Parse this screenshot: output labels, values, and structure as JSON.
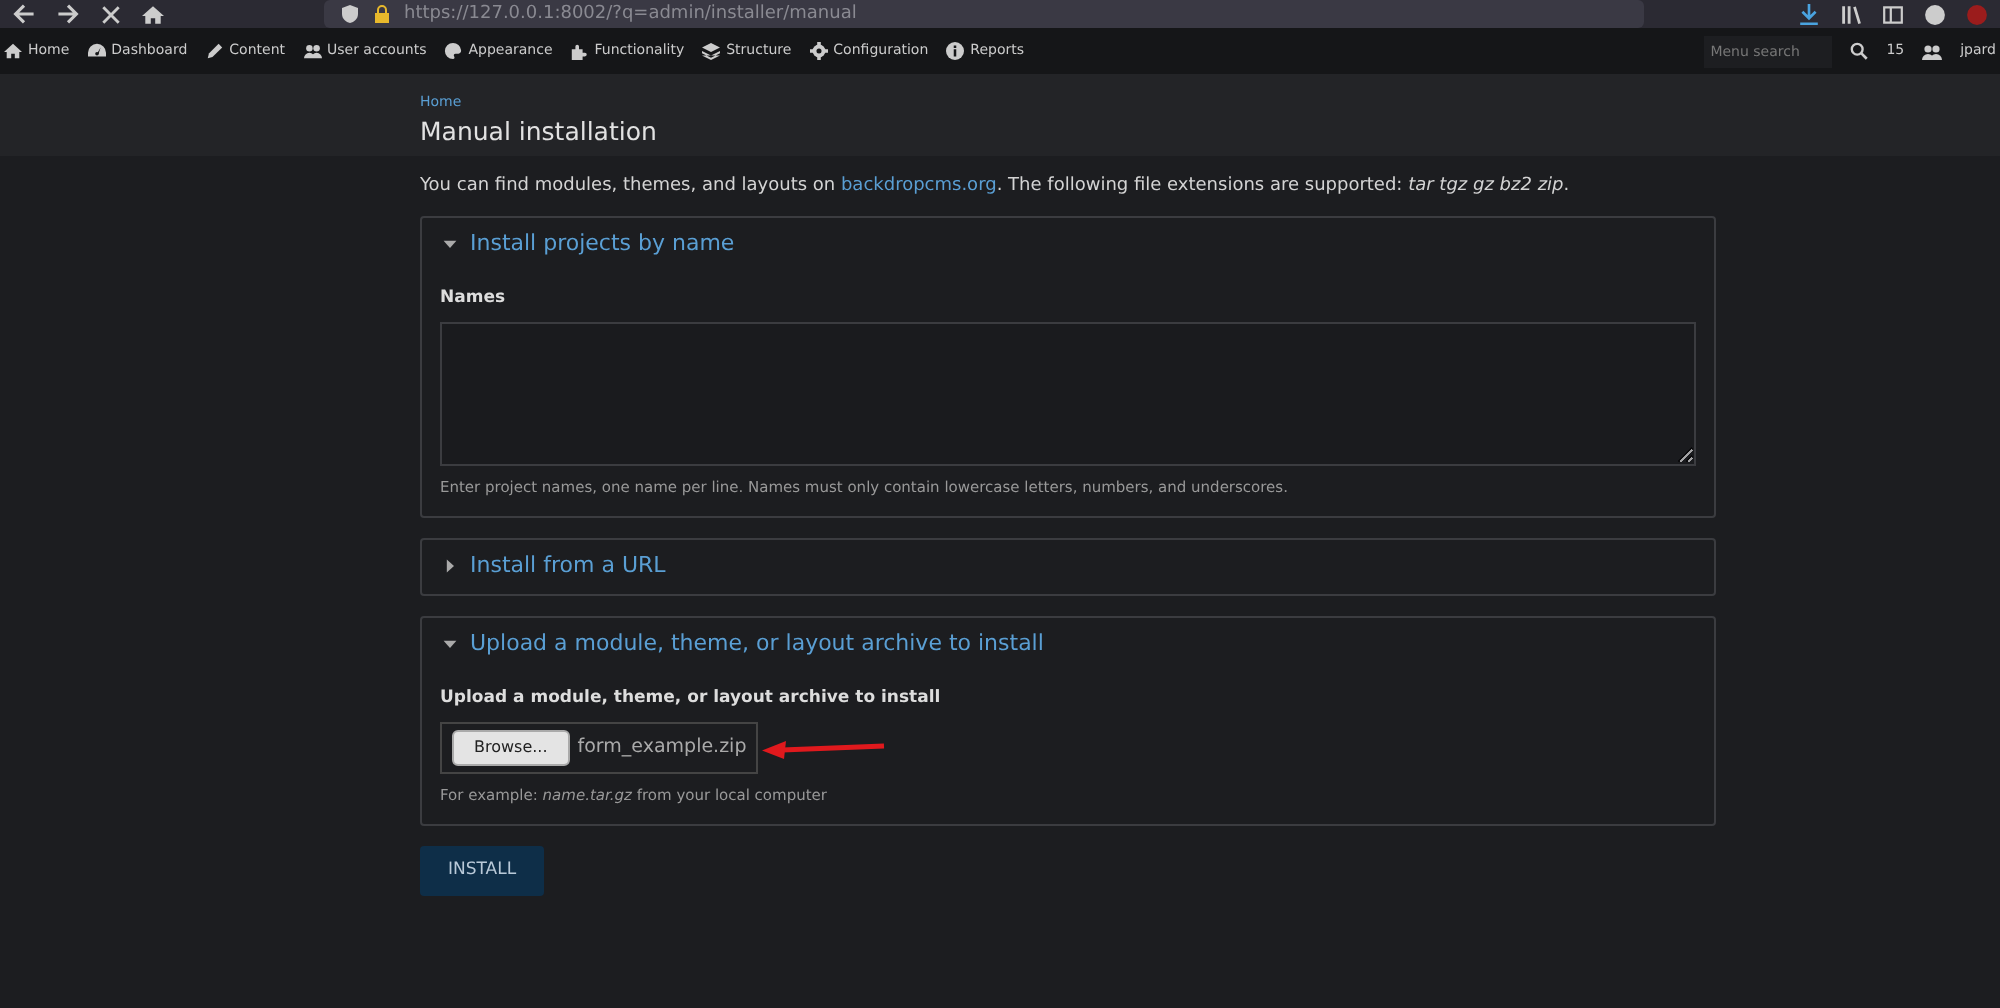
{
  "browser": {
    "url": "https://127.0.0.1:8002/?q=admin/installer/manual"
  },
  "admin_bar": {
    "items": [
      {
        "label": "Home"
      },
      {
        "label": "Dashboard"
      },
      {
        "label": "Content"
      },
      {
        "label": "User accounts"
      },
      {
        "label": "Appearance"
      },
      {
        "label": "Functionality"
      },
      {
        "label": "Structure"
      },
      {
        "label": "Configuration"
      },
      {
        "label": "Reports"
      }
    ],
    "search": {
      "placeholder": "Menu search"
    },
    "count": "15",
    "user": "jpard"
  },
  "breadcrumb": "Home",
  "page_title": "Manual installation",
  "intro": {
    "before": "You can find modules, themes, and layouts on ",
    "link": "backdropcms.org",
    "after": ". The following file extensions are supported: *tar tgz gz bz2 zip*."
  },
  "sections": [
    {
      "kind": "names",
      "title": "Install projects by name",
      "expanded": true,
      "label": "Names",
      "description": "Enter project names, one name per line. Names must only contain lowercase letters, numbers, and underscores."
    },
    {
      "title": "Install from a URL",
      "expanded": false
    },
    {
      "kind": "upload",
      "title": "Upload a module, theme, or layout archive to install",
      "expanded": true,
      "label": "Upload a module, theme, or layout archive to install",
      "button": "Browse...",
      "filename": "form_example.zip",
      "description": "For example: *name.tar.gz* from your local computer"
    }
  ],
  "submit": "INSTALL"
}
